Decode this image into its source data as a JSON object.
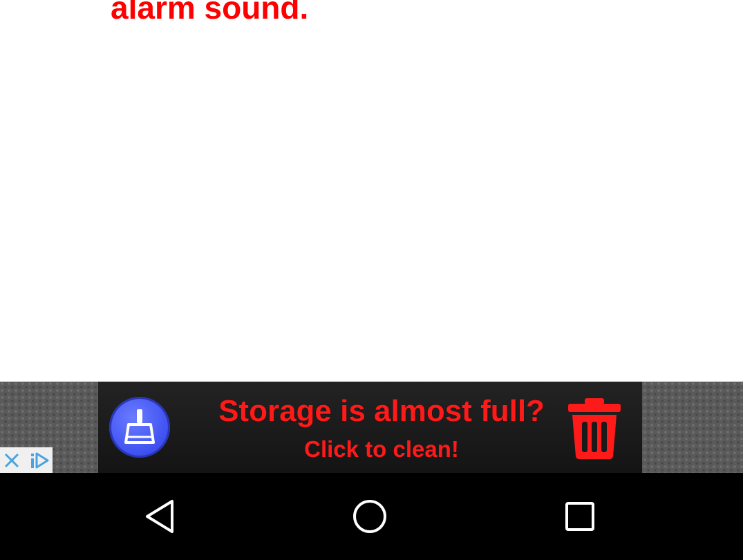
{
  "content": {
    "message": "alarm sound."
  },
  "ad": {
    "headline": "Storage is almost full?",
    "cta": "Click to clean!",
    "icons": {
      "badge": "broom-icon",
      "right": "trash-can-icon",
      "close": "close-icon",
      "choices": "ad-choices-icon"
    },
    "colors": {
      "text": "#ff1a1a",
      "badge": "#4455f5",
      "trash": "#ff1a1a"
    }
  },
  "navbar": {
    "icons": [
      "back-icon",
      "home-icon",
      "recents-icon"
    ]
  }
}
